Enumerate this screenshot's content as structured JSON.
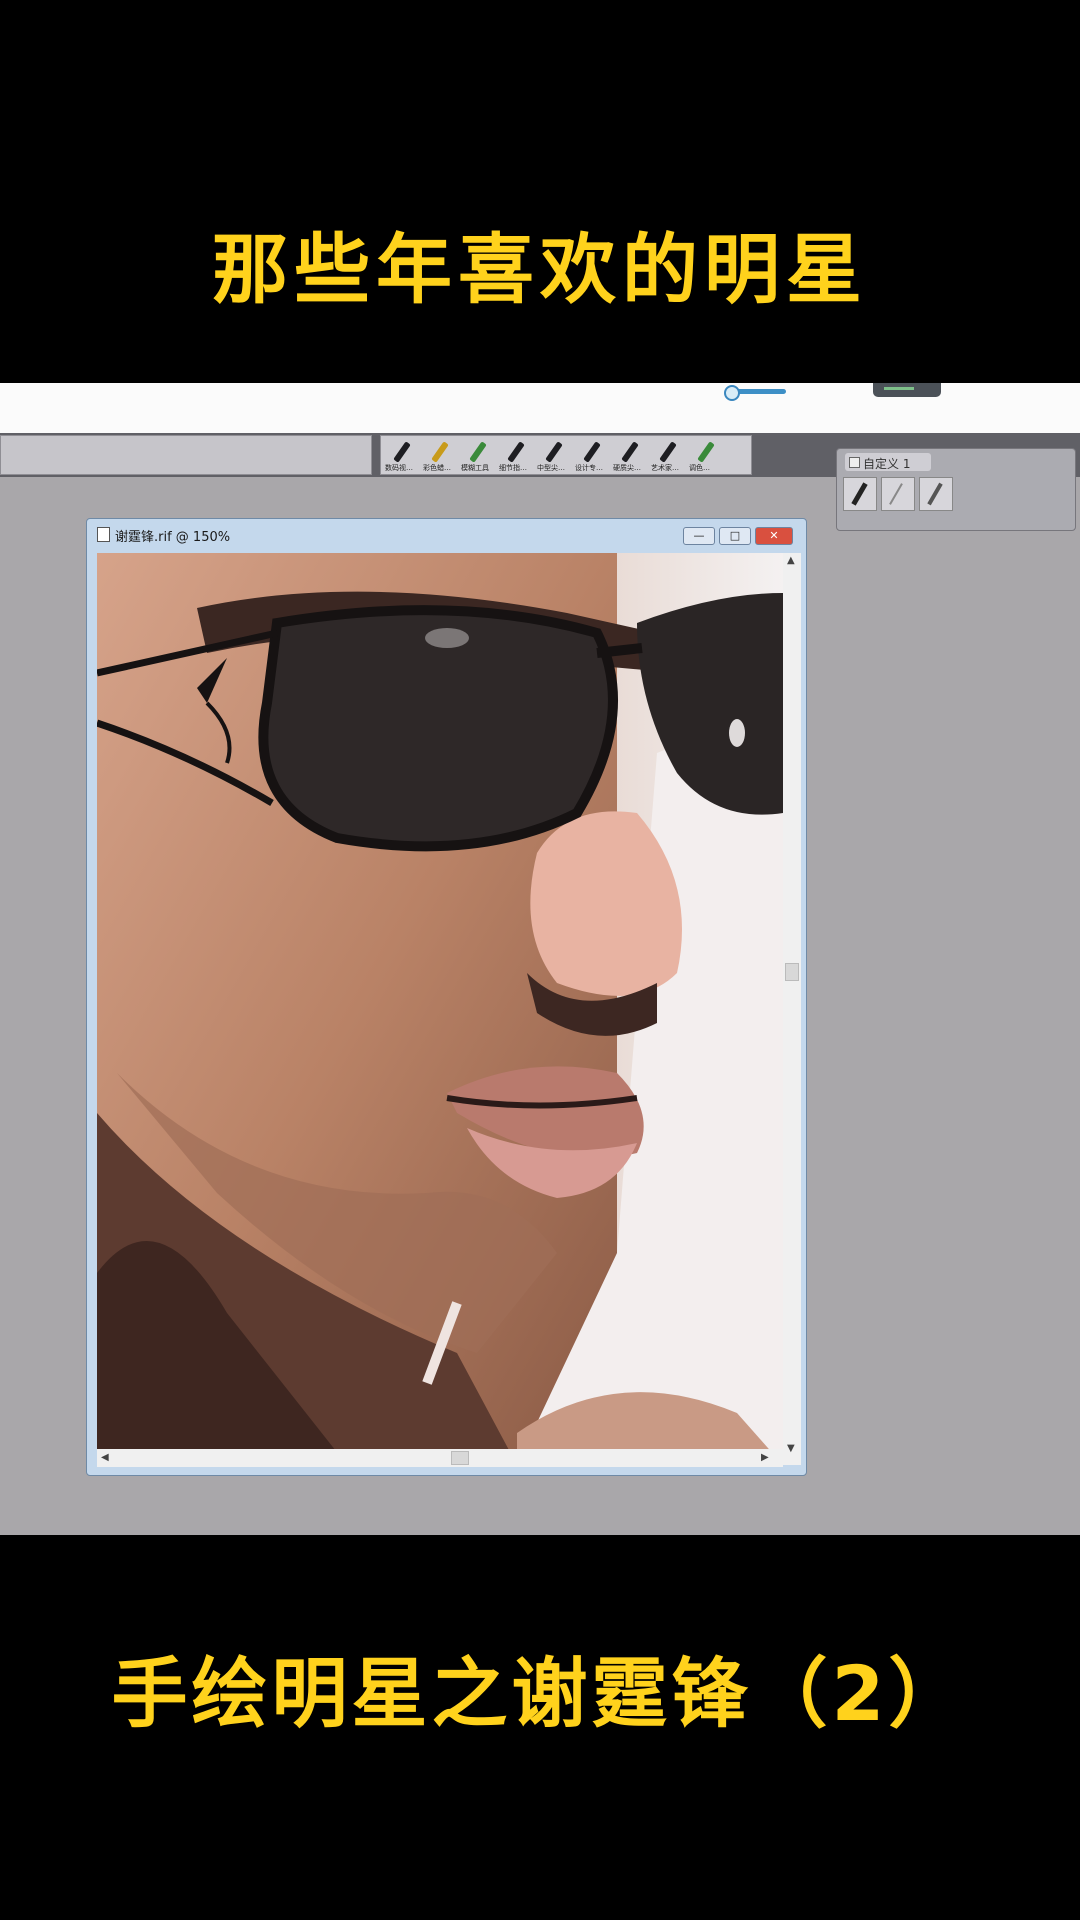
{
  "captions": {
    "top": "那些年喜欢的明星",
    "bottom": "手绘明星之谢霆锋（2）"
  },
  "brush_toolbar": {
    "items": [
      {
        "label": "数码视…",
        "icon": "pen-brush-icon"
      },
      {
        "label": "彩色蜡…",
        "icon": "crayon-brush-icon"
      },
      {
        "label": "模糊工具",
        "icon": "pencil-brush-icon"
      },
      {
        "label": "细节指…",
        "icon": "pen-brush-icon"
      },
      {
        "label": "中型尖…",
        "icon": "pen-brush-icon"
      },
      {
        "label": "设计专…",
        "icon": "pen-brush-icon"
      },
      {
        "label": "硬质尖…",
        "icon": "pen-brush-icon"
      },
      {
        "label": "艺术家…",
        "icon": "pen-brush-icon"
      },
      {
        "label": "调色…",
        "icon": "palette-knife-icon"
      }
    ]
  },
  "custom_panel": {
    "title": "自定义 1",
    "brush_count": 3
  },
  "document_window": {
    "title": "谢霆锋.rif @ 150%",
    "minimize_label": "—",
    "maximize_label": "□",
    "close_label": "✕"
  },
  "colors": {
    "caption": "#ffd21c",
    "workspace_bg": "#a9a7aa",
    "window_frame": "#c4d8ec",
    "close_button": "#d9503f"
  }
}
